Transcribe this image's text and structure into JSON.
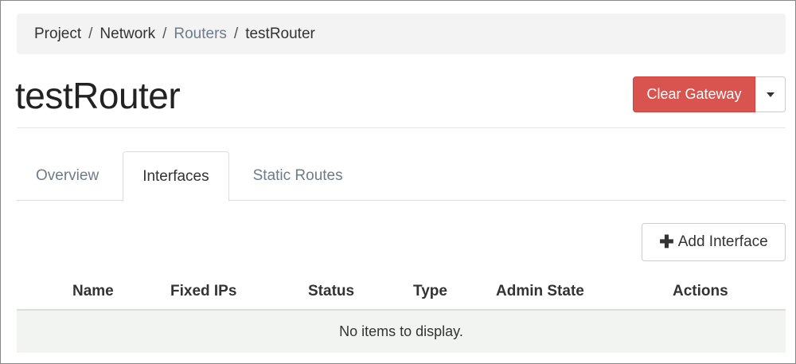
{
  "breadcrumb": {
    "items": [
      "Project",
      "Network",
      "Routers",
      "testRouter"
    ],
    "separator": "/"
  },
  "header": {
    "title": "testRouter",
    "clear_gateway_label": "Clear Gateway"
  },
  "tabs": [
    {
      "label": "Overview",
      "active": false
    },
    {
      "label": "Interfaces",
      "active": true
    },
    {
      "label": "Static Routes",
      "active": false
    }
  ],
  "toolbar": {
    "add_interface_label": "Add Interface",
    "add_icon": "plus-icon"
  },
  "table": {
    "columns": [
      "Name",
      "Fixed IPs",
      "Status",
      "Type",
      "Admin State",
      "Actions"
    ],
    "rows": [],
    "empty_message": "No items to display."
  },
  "colors": {
    "danger": "#d9534f",
    "link": "#6e7b8b",
    "breadcrumb_bg": "#f3f3f3",
    "empty_row_bg": "#f2f4f2"
  }
}
